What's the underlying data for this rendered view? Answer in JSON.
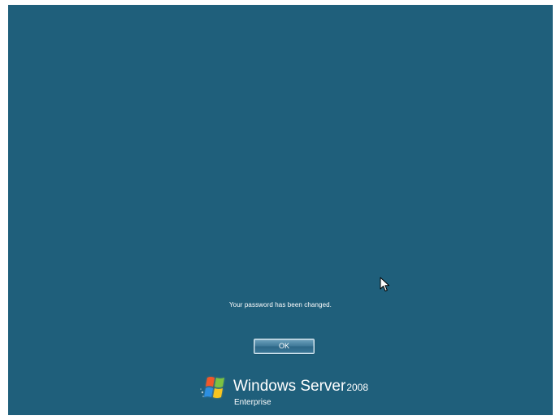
{
  "screen": {
    "background_color": "#1f5f7b"
  },
  "dialog": {
    "message": "Your password has been changed.",
    "ok_label": "OK"
  },
  "branding": {
    "name": "Windows Server",
    "version": "2008",
    "edition": "Enterprise",
    "logo_icon": "windows-flag-icon"
  },
  "cursor": {
    "icon": "mouse-pointer-icon"
  }
}
